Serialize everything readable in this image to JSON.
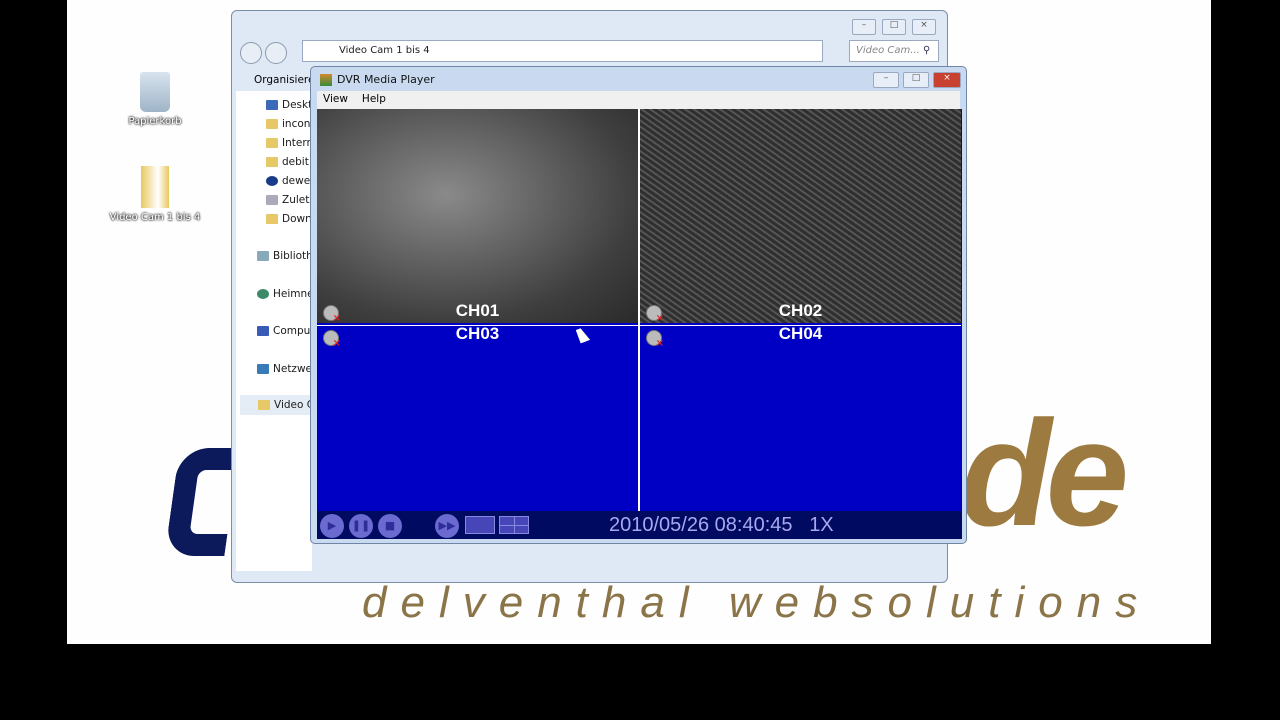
{
  "desktop": {
    "icons": [
      {
        "label": "Papierkorb",
        "icon": "recycle-bin-icon"
      },
      {
        "label": "Video Cam 1 bis 4",
        "icon": "folder-icon"
      }
    ],
    "logo_tagline": "delventhal   websolutions"
  },
  "explorer": {
    "address": "Video Cam 1 bis 4",
    "search_placeholder": "Video Cam...",
    "toolbar_organize": "Organisieren",
    "tree": [
      "Deskt",
      "incon",
      "Interr",
      "debit",
      "dewe",
      "Zuletz",
      "Down",
      "Biblioth",
      "Heimne",
      "Compu",
      "Netzwe",
      "Video C"
    ]
  },
  "dvr": {
    "title": "DVR Media Player",
    "menu": [
      "View",
      "Help"
    ],
    "channels": [
      "CH01",
      "CH02",
      "CH03",
      "CH04"
    ],
    "timestamp": "2010/05/26 08:40:45",
    "speed": "1X"
  }
}
